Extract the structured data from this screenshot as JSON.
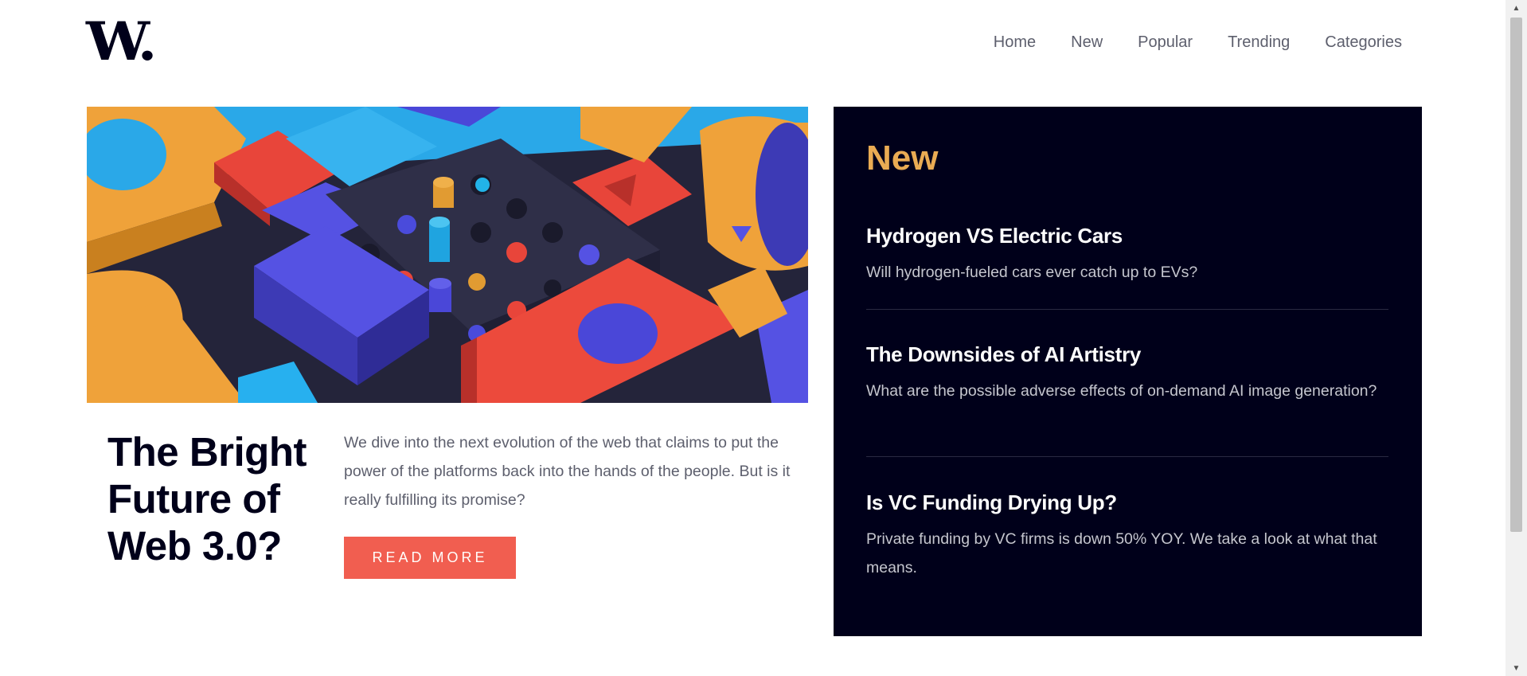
{
  "header": {
    "logo": "W.",
    "nav": [
      "Home",
      "New",
      "Popular",
      "Trending",
      "Categories"
    ]
  },
  "hero": {
    "image_alt": "Colorful 3D geometric blocks",
    "title": "The Bright Future of Web 3.0?",
    "description": "We dive into the next evolution of the web that claims to put the power of the platforms back into the hands of the people. But is it really fulfilling its promise?",
    "button": "READ MORE"
  },
  "new_section": {
    "heading": "New",
    "items": [
      {
        "title": "Hydrogen VS Electric Cars",
        "description": "Will hydrogen-fueled cars ever catch up to EVs?"
      },
      {
        "title": "The Downsides of AI Artistry",
        "description": "What are the possible adverse effects of on-demand AI image generation?"
      },
      {
        "title": "Is VC Funding Drying Up?",
        "description": "Private funding by VC firms is down 50% YOY. We take a look at what that means."
      }
    ]
  },
  "colors": {
    "dark_navy": "#00001a",
    "accent_orange": "#e9ab53",
    "button_red": "#f15e50",
    "text_gray": "#5d5f6d"
  }
}
